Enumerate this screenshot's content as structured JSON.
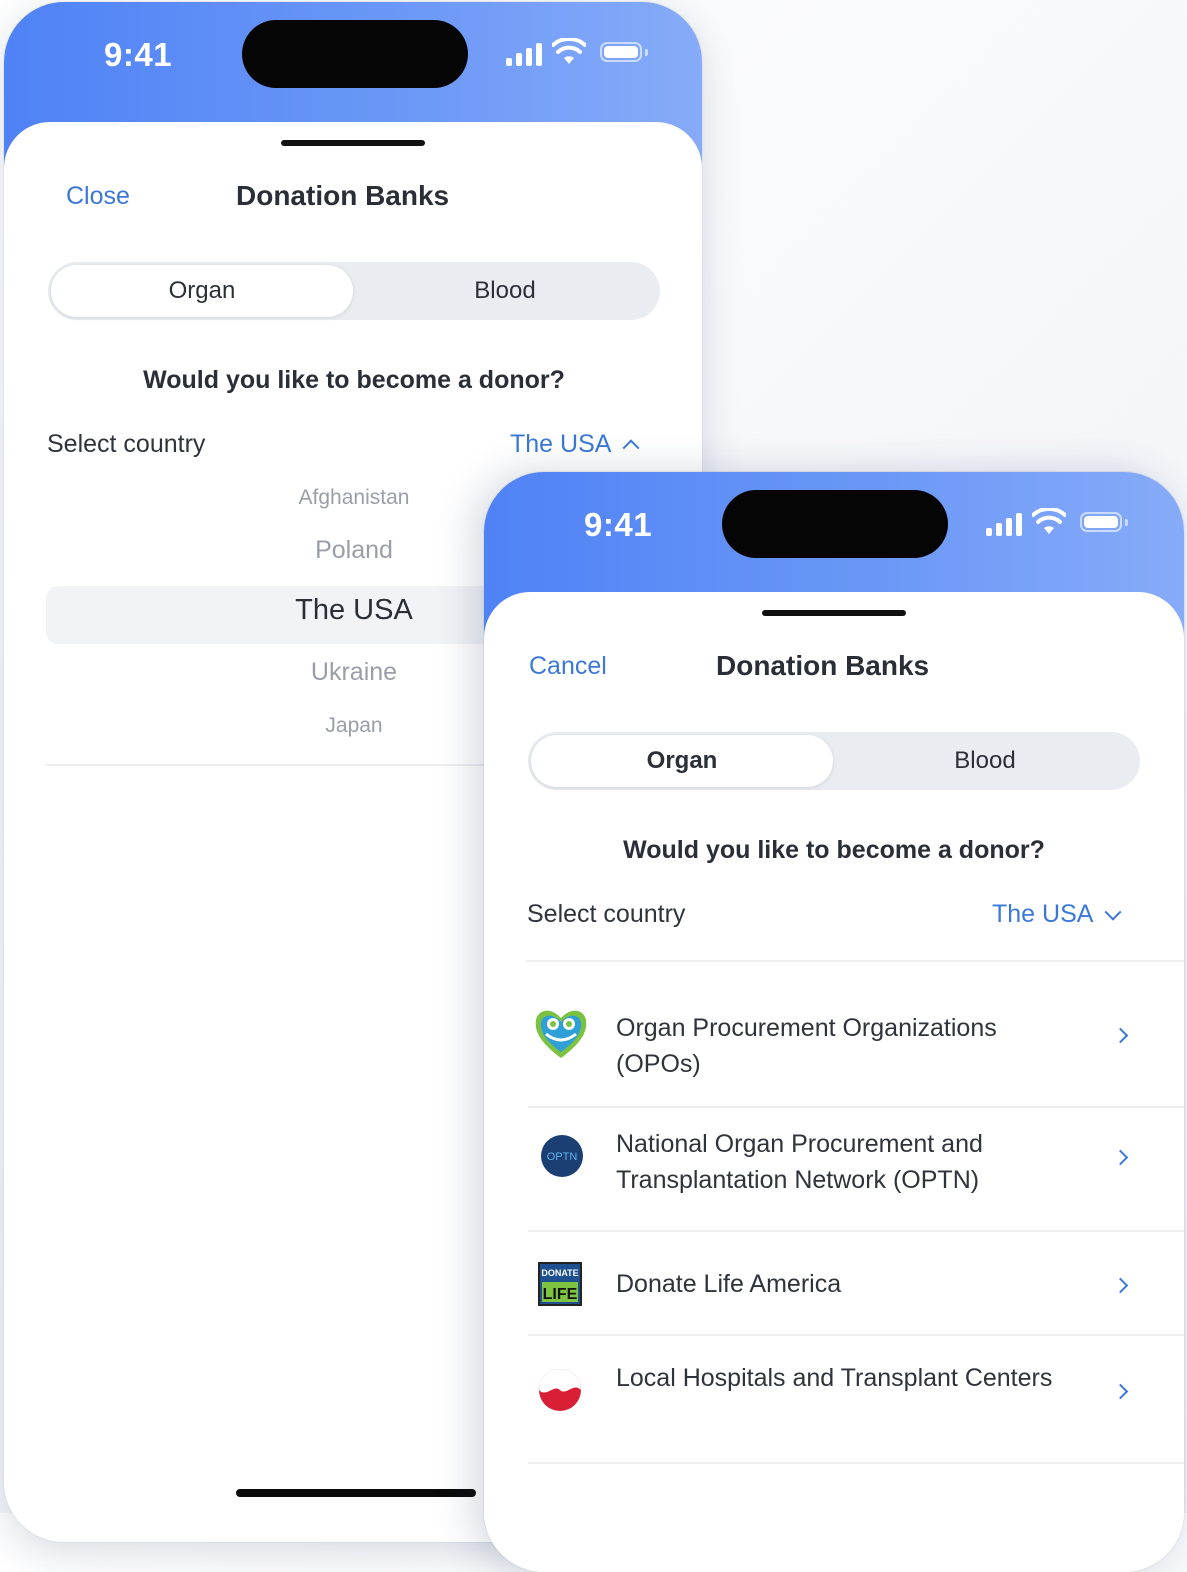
{
  "phone_back": {
    "status": {
      "time": "9:41"
    },
    "nav": {
      "left_action": "Close",
      "title": "Donation Banks"
    },
    "segments": [
      "Organ",
      "Blood"
    ],
    "question": "Would you like to become a donor?",
    "country": {
      "label": "Select country",
      "value": "The USA",
      "expanded": true
    },
    "picker": [
      "Afghanistan",
      "Poland",
      "The USA",
      "Ukraine",
      "Japan"
    ]
  },
  "phone_front": {
    "status": {
      "time": "9:41"
    },
    "nav": {
      "left_action": "Cancel",
      "title": "Donation Banks"
    },
    "segments": [
      "Organ",
      "Blood"
    ],
    "question": "Would you like to become a donor?",
    "country": {
      "label": "Select country",
      "value": "The USA",
      "expanded": false
    },
    "banks": [
      {
        "name": "Organ Procurement Organizations (OPOs)",
        "icon": "heart-hands-logo-icon"
      },
      {
        "name": "National Organ Procurement and Transplantation Network (OPTN)",
        "icon": "optn-logo-icon",
        "logo_text": "OPTN"
      },
      {
        "name": "Donate Life America",
        "icon": "donate-life-logo-icon",
        "logo_text": [
          "DONATE",
          "LIFE"
        ]
      },
      {
        "name": "Local Hospitals and Transplant Centers",
        "icon": "hospital-swirl-logo-icon"
      }
    ]
  },
  "colors": {
    "accent": "#3c78d8",
    "header_start": "#4f82f5",
    "header_end": "#86abf8"
  }
}
